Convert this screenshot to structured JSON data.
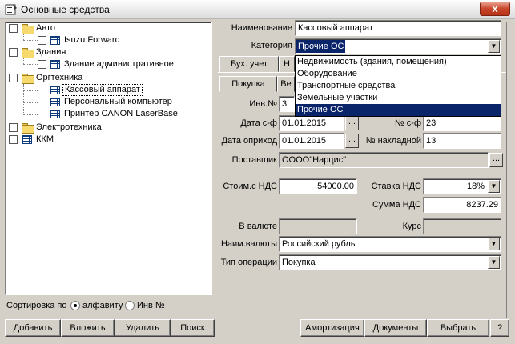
{
  "window": {
    "title": "Основные средства",
    "close_label": "x"
  },
  "tree": {
    "items": [
      {
        "label": "Авто",
        "type": "folder",
        "level": 0
      },
      {
        "label": "Isuzu Forward",
        "type": "item",
        "level": 1
      },
      {
        "label": "Здания",
        "type": "folder",
        "level": 0
      },
      {
        "label": "Здание административное",
        "type": "item",
        "level": 1
      },
      {
        "label": "Оргтехника",
        "type": "folder",
        "level": 0
      },
      {
        "label": "Кассовый аппарат",
        "type": "item",
        "level": 1,
        "selected": true
      },
      {
        "label": "Персональный компьютер",
        "type": "item",
        "level": 1
      },
      {
        "label": "Принтер CANON LaserBase",
        "type": "item",
        "level": 1
      },
      {
        "label": "Электротехника",
        "type": "folder",
        "level": 0
      },
      {
        "label": "ККМ",
        "type": "item",
        "level": 0
      }
    ]
  },
  "sort": {
    "label": "Сортировка по",
    "option_alpha": "алфавиту",
    "option_inv": "Инв №",
    "selected": "alpha"
  },
  "left_buttons": {
    "add": "Добавить",
    "insert": "Вложить",
    "delete": "Удалить",
    "search": "Поиск"
  },
  "form": {
    "name_label": "Наименование",
    "name_value": "Кассовый аппарат",
    "category_label": "Категория",
    "category_value": "Прочие ОС",
    "category_options": [
      "Недвижимость (здания, помещения)",
      "Оборудование",
      "Транспортные средства",
      "Земельные участки",
      "Прочие ОС"
    ],
    "tabs_top": [
      "Бух. учет",
      "Н"
    ],
    "tabs_sub": [
      "Покупка",
      "Ве"
    ],
    "inv_label": "Инв.№",
    "inv_value": "3",
    "invoice_date_label": "Дата с-ф",
    "invoice_date_value": "01.01.2015",
    "invoice_no_label": "№ с-ф",
    "invoice_no_value": "23",
    "receipt_date_label": "Дата оприход",
    "receipt_date_value": "01.01.2015",
    "waybill_label": "№ накладной",
    "waybill_value": "13",
    "supplier_label": "Поставщик",
    "supplier_value": "ОООО\"Нарцис\"",
    "cost_label": "Стоим.с НДС",
    "cost_value": "54000.00",
    "vat_rate_label": "Ставка НДС",
    "vat_rate_value": "18%",
    "vat_sum_label": "Сумма НДС",
    "vat_sum_value": "8237.29",
    "currency_amount_label": "В валюте",
    "currency_amount_value": "",
    "rate_label": "Курс",
    "rate_value": "",
    "currency_name_label": "Наим.валюты",
    "currency_name_value": "Российский рубль",
    "operation_label": "Тип операции",
    "operation_value": "Покупка",
    "ellipsis": "..."
  },
  "right_buttons": {
    "amortization": "Амортизация",
    "documents": "Документы",
    "select": "Выбрать",
    "help": "?"
  },
  "icons": {
    "title": "app-icon",
    "folder": "folder-icon",
    "item": "grid-icon"
  }
}
